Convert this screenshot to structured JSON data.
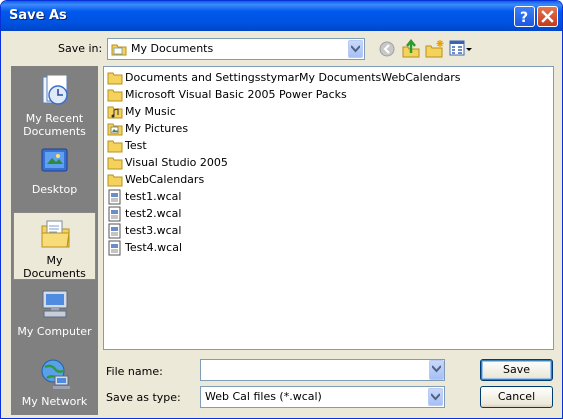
{
  "window": {
    "title": "Save As"
  },
  "save_in": {
    "label": "Save in:",
    "value": "My Documents"
  },
  "toolbar": {
    "icons": [
      "back-icon",
      "up-folder-icon",
      "new-folder-icon",
      "views-menu-icon"
    ]
  },
  "places": [
    {
      "label": "My Recent Documents",
      "line1": "My Recent",
      "line2": "Documents",
      "icon": "recent-documents-icon",
      "selected": false
    },
    {
      "label": "Desktop",
      "line1": "Desktop",
      "line2": "",
      "icon": "desktop-icon",
      "selected": false
    },
    {
      "label": "My Documents",
      "line1": "My Documents",
      "line2": "",
      "icon": "my-documents-icon",
      "selected": true
    },
    {
      "label": "My Computer",
      "line1": "My Computer",
      "line2": "",
      "icon": "my-computer-icon",
      "selected": false
    },
    {
      "label": "My Network",
      "line1": "My Network",
      "line2": "",
      "icon": "my-network-icon",
      "selected": false
    }
  ],
  "files": [
    {
      "name": "Documents and SettingsstymarMy DocumentsWebCalendars",
      "type": "folder"
    },
    {
      "name": "Microsoft Visual Basic 2005 Power Packs",
      "type": "folder"
    },
    {
      "name": "My Music",
      "type": "music-folder"
    },
    {
      "name": "My Pictures",
      "type": "pictures-folder"
    },
    {
      "name": "Test",
      "type": "folder"
    },
    {
      "name": "Visual Studio 2005",
      "type": "folder"
    },
    {
      "name": "WebCalendars",
      "type": "folder"
    },
    {
      "name": "test1.wcal",
      "type": "file"
    },
    {
      "name": "test2.wcal",
      "type": "file"
    },
    {
      "name": "test3.wcal",
      "type": "file"
    },
    {
      "name": "Test4.wcal",
      "type": "file"
    }
  ],
  "file_name": {
    "label": "File name:",
    "value": "",
    "placeholder": ""
  },
  "save_as_type": {
    "label": "Save as type:",
    "value": "Web Cal files (*.wcal)"
  },
  "buttons": {
    "save": "Save",
    "cancel": "Cancel",
    "help": "?",
    "close": "X"
  },
  "colors": {
    "title_bar": "#0058ee",
    "dialog_bg": "#ece9d8",
    "places_bar": "#808080",
    "folder": "#f4d25c"
  }
}
